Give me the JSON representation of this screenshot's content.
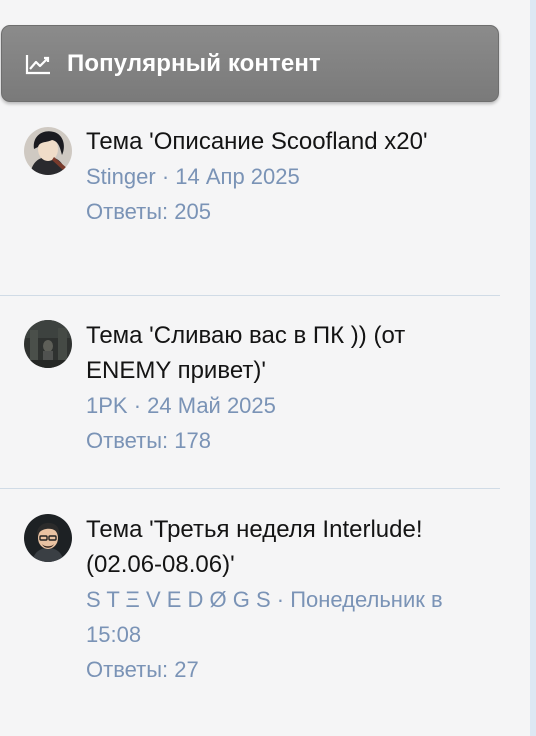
{
  "widget": {
    "title": "Популярный контент",
    "icon": "chart-line-icon"
  },
  "items": [
    {
      "title": "Тема 'Описание Scoofland x20'",
      "author": "Stinger",
      "separator": " · ",
      "date": "14 Апр 2025",
      "replies": "Ответы: 205"
    },
    {
      "title": "Тема 'Сливаю вас в ПК )) (от ENEMY привет)'",
      "author": "1PK",
      "separator": " · ",
      "date": "24 Май 2025",
      "replies": "Ответы: 178"
    },
    {
      "title": "Тема 'Третья неделя Interlude! (02.06-08.06)'",
      "author": "S T Ξ V E D Ø G S",
      "separator": " · ",
      "date": "Понедельник в 15:08",
      "replies": "Ответы: 27"
    }
  ],
  "colors": {
    "header_bg": "#7f7f7f",
    "title_text": "#141414",
    "meta_text": "#7a93b6",
    "separator": "#d0dbe6"
  }
}
